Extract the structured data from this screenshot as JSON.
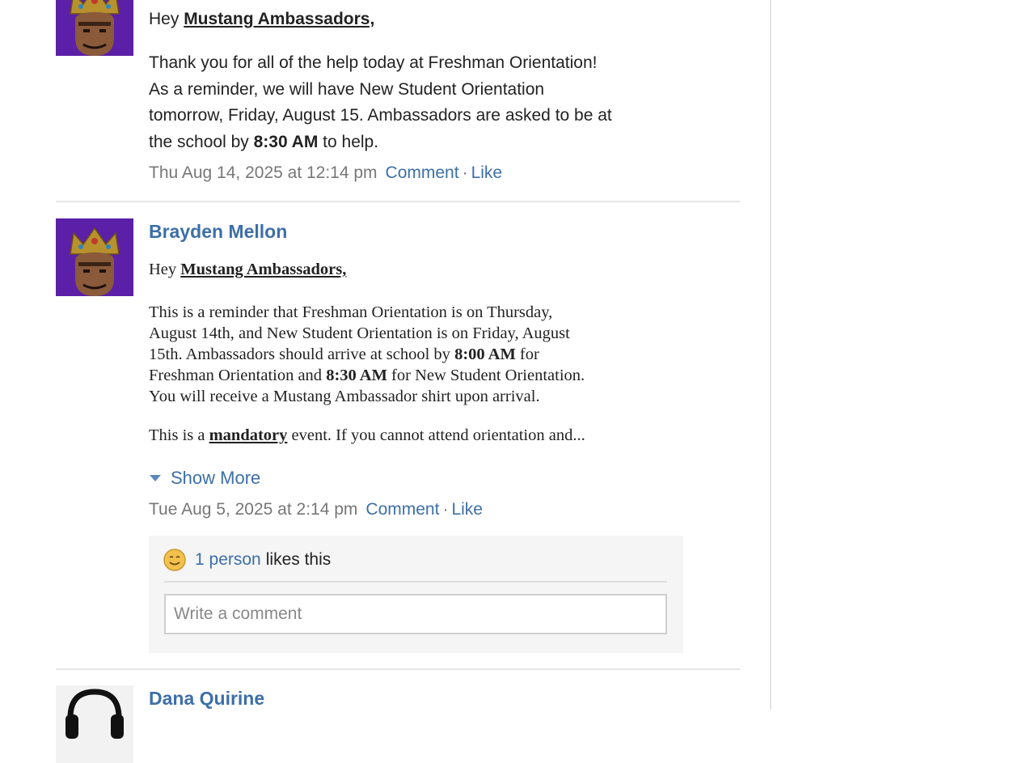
{
  "posts": [
    {
      "greeting_prefix": "Hey ",
      "greeting_group": "Mustang Ambassadors, ",
      "body_line1": "Thank you for all of the help today at Freshman Orientation!",
      "body_line2": "As a reminder, we will have New Student Orientation",
      "body_line3": "tomorrow, Friday, August 15. Ambassadors are asked to be at",
      "body_line4_pre": "the school by ",
      "body_line4_time": "8:30 AM",
      "body_line4_post": " to help.",
      "timestamp": "Thu Aug 14, 2025 at 12:14 pm",
      "comment_label": "Comment",
      "separator": "·",
      "like_label": "Like",
      "avatar_icon": "crowned-avatar"
    },
    {
      "author": "Brayden Mellon",
      "greeting_prefix": "Hey ",
      "greeting_group": "Mustang Ambassadors,",
      "para1_line1": "This is a reminder that Freshman Orientation is on Thursday,",
      "para1_line2": "August 14th, and New Student Orientation is on Friday, August",
      "para1_line3_pre": "15th. Ambassadors should arrive at school by ",
      "para1_line3_time": "8:00 AM",
      "para1_line3_post": " for",
      "para1_line4_pre": "Freshman Orientation and ",
      "para1_line4_time": "8:30 AM",
      "para1_line4_post": " for New Student Orientation.",
      "para1_line5": "You will receive a Mustang Ambassador shirt upon arrival.",
      "para2_pre": "This is a ",
      "para2_emph": "mandatory",
      "para2_post": " event. If you cannot attend orientation and...",
      "show_more_label": "Show More",
      "timestamp": "Tue Aug 5, 2025 at 2:14 pm",
      "comment_label": "Comment",
      "separator": "·",
      "like_label": "Like",
      "likes_count_label": "1 person",
      "likes_suffix": "likes this",
      "comment_placeholder": "Write a comment",
      "avatar_icon": "crowned-avatar"
    },
    {
      "author": "Dana Quirine",
      "avatar_icon": "headphones-avatar"
    }
  ],
  "colors": {
    "link": "#3c6fa8",
    "meta_text": "#777777",
    "avatar_bg": "#5b1fa8",
    "likes_box_bg": "#f5f5f5"
  }
}
